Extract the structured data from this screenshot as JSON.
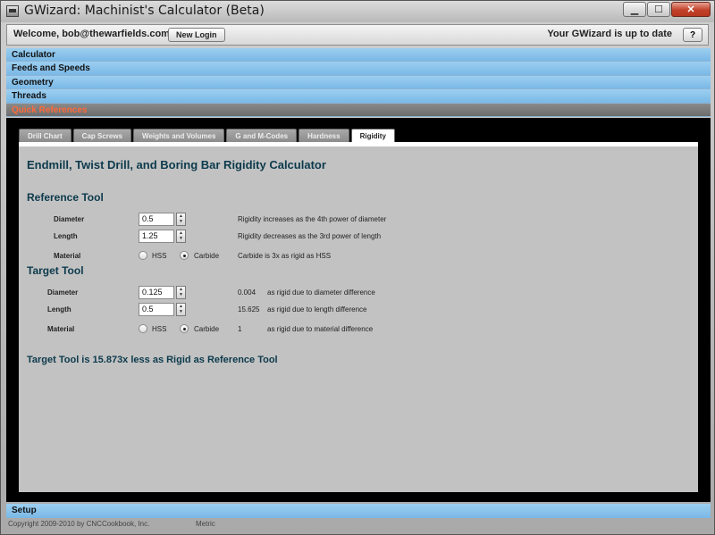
{
  "window": {
    "title": "GWizard: Machinist's Calculator (Beta)"
  },
  "welcome": {
    "text": "Welcome, bob@thewarfields.com!",
    "login_button": "New Login",
    "status": "Your GWizard is up to date",
    "help_button": "?"
  },
  "accordion": {
    "items": [
      {
        "label": "Calculator"
      },
      {
        "label": "Feeds and Speeds"
      },
      {
        "label": "Geometry"
      },
      {
        "label": "Threads"
      },
      {
        "label": "Quick References"
      }
    ],
    "active_color": "#ff6a3a"
  },
  "tabs": [
    {
      "label": "Drill Chart"
    },
    {
      "label": "Cap Screws"
    },
    {
      "label": "Weights and Volumes"
    },
    {
      "label": "G and M-Codes"
    },
    {
      "label": "Hardness"
    },
    {
      "label": "Rigidity"
    }
  ],
  "rigidity": {
    "title": "Endmill, Twist Drill, and Boring Bar Rigidity Calculator",
    "reference": {
      "heading": "Reference Tool",
      "diameter_label": "Diameter",
      "diameter_value": "0.5",
      "diameter_note": "Rigidity increases as the 4th power of diameter",
      "length_label": "Length",
      "length_value": "1.25",
      "length_note": "Rigidity decreases as the 3rd power of length",
      "material_label": "Material",
      "option_hss": "HSS",
      "option_carbide": "Carbide",
      "selected_material": "Carbide",
      "material_note": "Carbide is 3x as rigid as HSS"
    },
    "target": {
      "heading": "Target Tool",
      "diameter_label": "Diameter",
      "diameter_value": "0.125",
      "diameter_factor": "0.004",
      "diameter_note": "as rigid due to diameter difference",
      "length_label": "Length",
      "length_value": "0.5",
      "length_factor": "15.625",
      "length_note": "as rigid due to length difference",
      "material_label": "Material",
      "option_hss": "HSS",
      "option_carbide": "Carbide",
      "selected_material": "Carbide",
      "material_factor": "1",
      "material_note": "as rigid due to material difference"
    },
    "result": "Target Tool is 15.873x less as Rigid as Reference Tool"
  },
  "setup": {
    "label": "Setup"
  },
  "footer": {
    "copyright": "Copyright 2009-2010 by CNCCookbook, Inc.",
    "units": "Metric"
  }
}
